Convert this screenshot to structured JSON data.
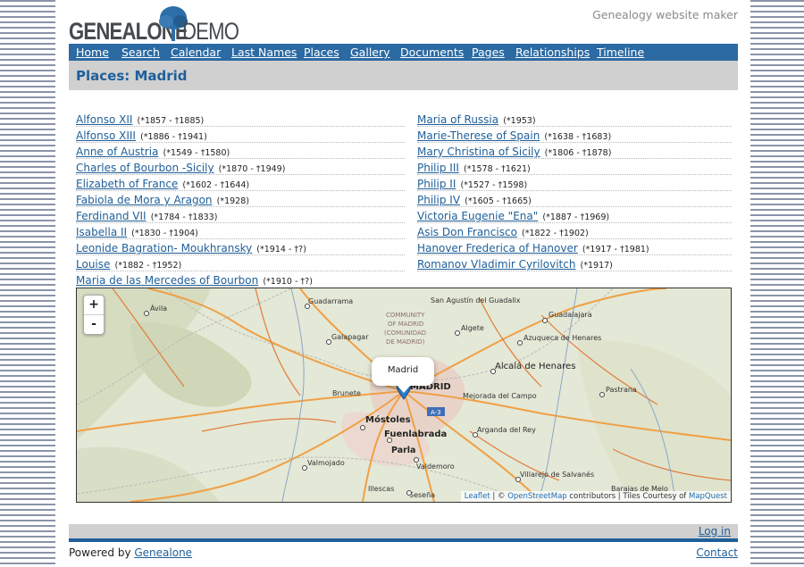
{
  "header": {
    "logo_text_a": "GENEALONE",
    "logo_text_b": "DEMO",
    "tagline": "Genealogy website maker"
  },
  "nav": {
    "items": [
      "Home",
      "Search",
      "Calendar",
      "Last Names",
      "Places",
      "Gallery",
      "Documents",
      "Pages",
      "Relationships",
      "Timeline"
    ]
  },
  "page": {
    "title": "Places: Madrid"
  },
  "people": {
    "left": [
      {
        "name": "Alfonso XII",
        "dates": "(*1857 - †1885)"
      },
      {
        "name": "Alfonso XIII",
        "dates": "(*1886 - †1941)"
      },
      {
        "name": "Anne of Austria",
        "dates": "(*1549 - †1580)"
      },
      {
        "name": "Charles of Bourbon -Sicily",
        "dates": "(*1870 - †1949)"
      },
      {
        "name": "Elizabeth of France",
        "dates": "(*1602 - †1644)"
      },
      {
        "name": "Fabiola de Mora y Aragon",
        "dates": "(*1928)"
      },
      {
        "name": "Ferdinand VII",
        "dates": "(*1784 - †1833)"
      },
      {
        "name": "Isabella II",
        "dates": "(*1830 - †1904)"
      },
      {
        "name": "Leonide Bagration- Moukhransky",
        "dates": "(*1914 - †?)"
      },
      {
        "name": "Louise",
        "dates": "(*1882 - †1952)"
      },
      {
        "name": "Maria de las Mercedes of Bourbon",
        "dates": "(*1910 - †?)"
      }
    ],
    "right": [
      {
        "name": "Maria of Russia",
        "dates": "(*1953)"
      },
      {
        "name": "Marie-Therese of Spain",
        "dates": "(*1638 - †1683)"
      },
      {
        "name": "Mary Christina of Sicily",
        "dates": "(*1806 - †1878)"
      },
      {
        "name": "Philip III",
        "dates": "(*1578 - †1621)"
      },
      {
        "name": "Philip II",
        "dates": "(*1527 - †1598)"
      },
      {
        "name": "Philip IV",
        "dates": "(*1605 - †1665)"
      },
      {
        "name": "Victoria Eugenie \"Ena\"",
        "dates": "(*1887 - †1969)"
      },
      {
        "name": "Asis Don Francisco",
        "dates": "(*1822 - †1902)"
      },
      {
        "name": "Hanover Frederica of Hanover",
        "dates": "(*1917 - †1981)"
      },
      {
        "name": "Romanov Vladimir Cyrilovitch",
        "dates": "(*1917)"
      }
    ]
  },
  "map": {
    "zoom_in": "+",
    "zoom_out": "-",
    "popup": "Madrid",
    "attribution": {
      "leaflet": "Leaflet",
      "sep": " | © ",
      "osm": "OpenStreetMap",
      "mid": " contributors | Tiles Courtesy of ",
      "mapquest": "MapQuest"
    },
    "labels": [
      "San Agustín del Guadalix",
      "Guadalajara",
      "Azuqueca de Henares",
      "Alcalá de Henares",
      "Pastrana",
      "Ávila",
      "Guadarrama",
      "COMMUNITY",
      "OF MADRID",
      "(COMUNIDAD",
      "DE MADRID)",
      "Galapagar",
      "Algete",
      "Brunete",
      "MADRID",
      "Mejorada del Campo",
      "A-3",
      "Móstoles",
      "Fuenlabrada",
      "Arganda del Rey",
      "Parla",
      "Valmojado",
      "Valdemoro",
      "Villarejo de Salvanés",
      "Illescas",
      "Seseña",
      "Barajas de Melo"
    ]
  },
  "footer": {
    "login": "Log in",
    "powered_prefix": "Powered by ",
    "powered_link": "Genealone",
    "contact": "Contact"
  }
}
